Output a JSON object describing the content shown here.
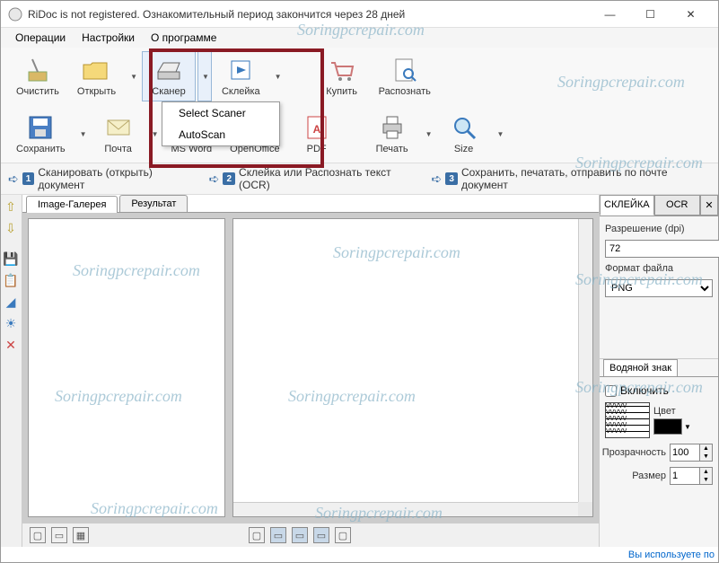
{
  "titlebar": {
    "text": "RiDoc is not registered. Ознакомительный период закончится через 28 дней"
  },
  "menubar": {
    "items": [
      "Операции",
      "Настройки",
      "О программе"
    ]
  },
  "toolbar1": {
    "clear": "Очистить",
    "open": "Открыть",
    "scanner": "Сканер",
    "stitch": "Склейка",
    "buy": "Купить",
    "recognize": "Распознать"
  },
  "toolbar2": {
    "save": "Сохранить",
    "mail": "Почта",
    "msword": "MS Word",
    "openoffice": "OpenOffice",
    "pdf": "PDF",
    "print": "Печать",
    "size": "Size"
  },
  "scanner_dropdown": {
    "select": "Select Scaner",
    "auto": "AutoScan"
  },
  "steps": {
    "s1": "Сканировать (открыть) документ",
    "s2": "Склейка или Распознать текст (OCR)",
    "s3": "Сохранить, печатать, отправить по почте документ"
  },
  "main_tabs": {
    "gallery": "Image-Галерея",
    "result": "Результат"
  },
  "right_panel": {
    "tab_stitch": "СКЛЕЙКА",
    "tab_ocr": "OCR",
    "resolution_label": "Разрешение (dpi)",
    "resolution_value": "72",
    "format_label": "Формат файла",
    "format_value": "PNG"
  },
  "watermark_panel": {
    "tab": "Водяной знак",
    "enable": "Включить",
    "color_label": "Цвет",
    "transparency_label": "Прозрачность",
    "transparency_value": "100",
    "size_label": "Размер",
    "size_value": "1"
  },
  "status": {
    "link": "Вы используете по"
  },
  "watermark_overlay": "Soringpcrepair.com"
}
